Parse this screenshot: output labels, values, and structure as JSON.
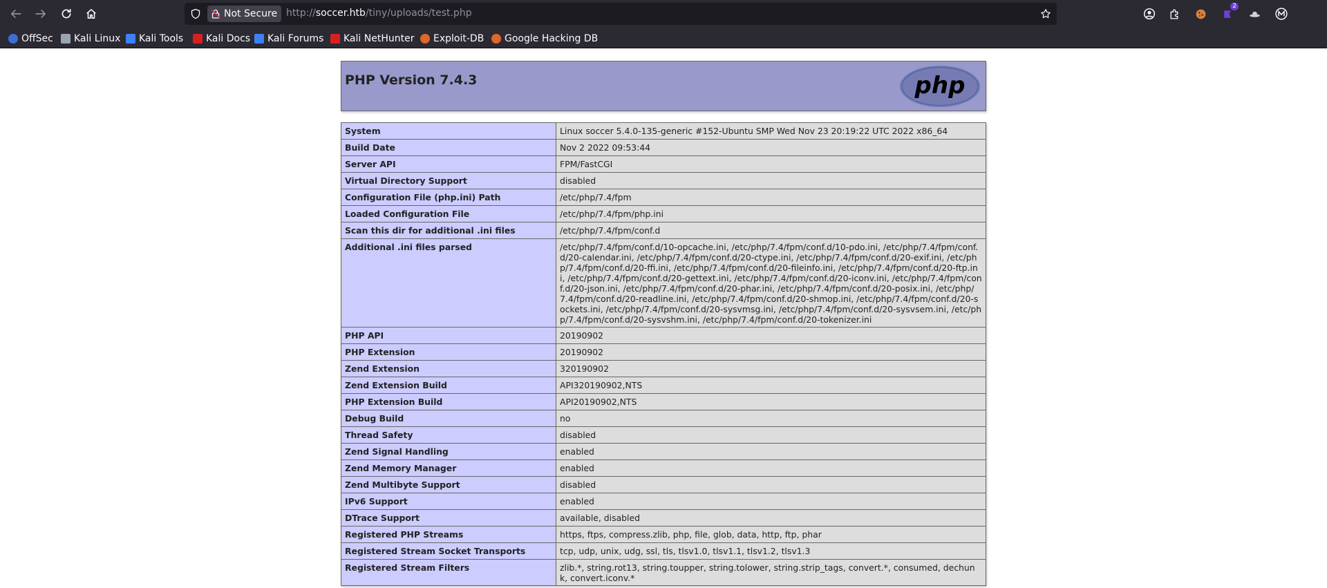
{
  "browser": {
    "security_label": "Not Secure",
    "url_prefix": "http://",
    "url_host": "soccer.htb",
    "url_path": "/tiny/uploads/test.php",
    "bookmarks": [
      {
        "label": "OffSec",
        "color": "#3b6fd6"
      },
      {
        "label": "Kali Linux",
        "color": "#9aa4b1"
      },
      {
        "label": "Kali Tools",
        "color": "#3b82f6"
      },
      {
        "label": "Kali Docs",
        "color": "#d92020"
      },
      {
        "label": "Kali Forums",
        "color": "#3b82f6"
      },
      {
        "label": "Kali NetHunter",
        "color": "#d92020"
      },
      {
        "label": "Exploit-DB",
        "color": "#e0662a"
      },
      {
        "label": "Google Hacking DB",
        "color": "#e0662a"
      }
    ],
    "extension_badge": "2"
  },
  "phpinfo": {
    "title": "PHP Version 7.4.3",
    "logo_text": "php",
    "rows": [
      {
        "key": "System",
        "value": "Linux soccer 5.4.0-135-generic #152-Ubuntu SMP Wed Nov 23 20:19:22 UTC 2022 x86_64"
      },
      {
        "key": "Build Date",
        "value": "Nov 2 2022 09:53:44"
      },
      {
        "key": "Server API",
        "value": "FPM/FastCGI"
      },
      {
        "key": "Virtual Directory Support",
        "value": "disabled"
      },
      {
        "key": "Configuration File (php.ini) Path",
        "value": "/etc/php/7.4/fpm"
      },
      {
        "key": "Loaded Configuration File",
        "value": "/etc/php/7.4/fpm/php.ini"
      },
      {
        "key": "Scan this dir for additional .ini files",
        "value": "/etc/php/7.4/fpm/conf.d"
      },
      {
        "key": "Additional .ini files parsed",
        "value": "/etc/php/7.4/fpm/conf.d/10-opcache.ini, /etc/php/7.4/fpm/conf.d/10-pdo.ini, /etc/php/7.4/fpm/conf.d/20-calendar.ini, /etc/php/7.4/fpm/conf.d/20-ctype.ini, /etc/php/7.4/fpm/conf.d/20-exif.ini, /etc/php/7.4/fpm/conf.d/20-ffi.ini, /etc/php/7.4/fpm/conf.d/20-fileinfo.ini, /etc/php/7.4/fpm/conf.d/20-ftp.ini, /etc/php/7.4/fpm/conf.d/20-gettext.ini, /etc/php/7.4/fpm/conf.d/20-iconv.ini, /etc/php/7.4/fpm/conf.d/20-json.ini, /etc/php/7.4/fpm/conf.d/20-phar.ini, /etc/php/7.4/fpm/conf.d/20-posix.ini, /etc/php/7.4/fpm/conf.d/20-readline.ini, /etc/php/7.4/fpm/conf.d/20-shmop.ini, /etc/php/7.4/fpm/conf.d/20-sockets.ini, /etc/php/7.4/fpm/conf.d/20-sysvmsg.ini, /etc/php/7.4/fpm/conf.d/20-sysvsem.ini, /etc/php/7.4/fpm/conf.d/20-sysvshm.ini, /etc/php/7.4/fpm/conf.d/20-tokenizer.ini"
      },
      {
        "key": "PHP API",
        "value": "20190902"
      },
      {
        "key": "PHP Extension",
        "value": "20190902"
      },
      {
        "key": "Zend Extension",
        "value": "320190902"
      },
      {
        "key": "Zend Extension Build",
        "value": "API320190902,NTS"
      },
      {
        "key": "PHP Extension Build",
        "value": "API20190902,NTS"
      },
      {
        "key": "Debug Build",
        "value": "no"
      },
      {
        "key": "Thread Safety",
        "value": "disabled"
      },
      {
        "key": "Zend Signal Handling",
        "value": "enabled"
      },
      {
        "key": "Zend Memory Manager",
        "value": "enabled"
      },
      {
        "key": "Zend Multibyte Support",
        "value": "disabled"
      },
      {
        "key": "IPv6 Support",
        "value": "enabled"
      },
      {
        "key": "DTrace Support",
        "value": "available, disabled"
      },
      {
        "key": "Registered PHP Streams",
        "value": "https, ftps, compress.zlib, php, file, glob, data, http, ftp, phar"
      },
      {
        "key": "Registered Stream Socket Transports",
        "value": "tcp, udp, unix, udg, ssl, tls, tlsv1.0, tlsv1.1, tlsv1.2, tlsv1.3"
      },
      {
        "key": "Registered Stream Filters",
        "value": "zlib.*, string.rot13, string.toupper, string.tolower, string.strip_tags, convert.*, consumed, dechunk, convert.iconv.*"
      }
    ]
  }
}
